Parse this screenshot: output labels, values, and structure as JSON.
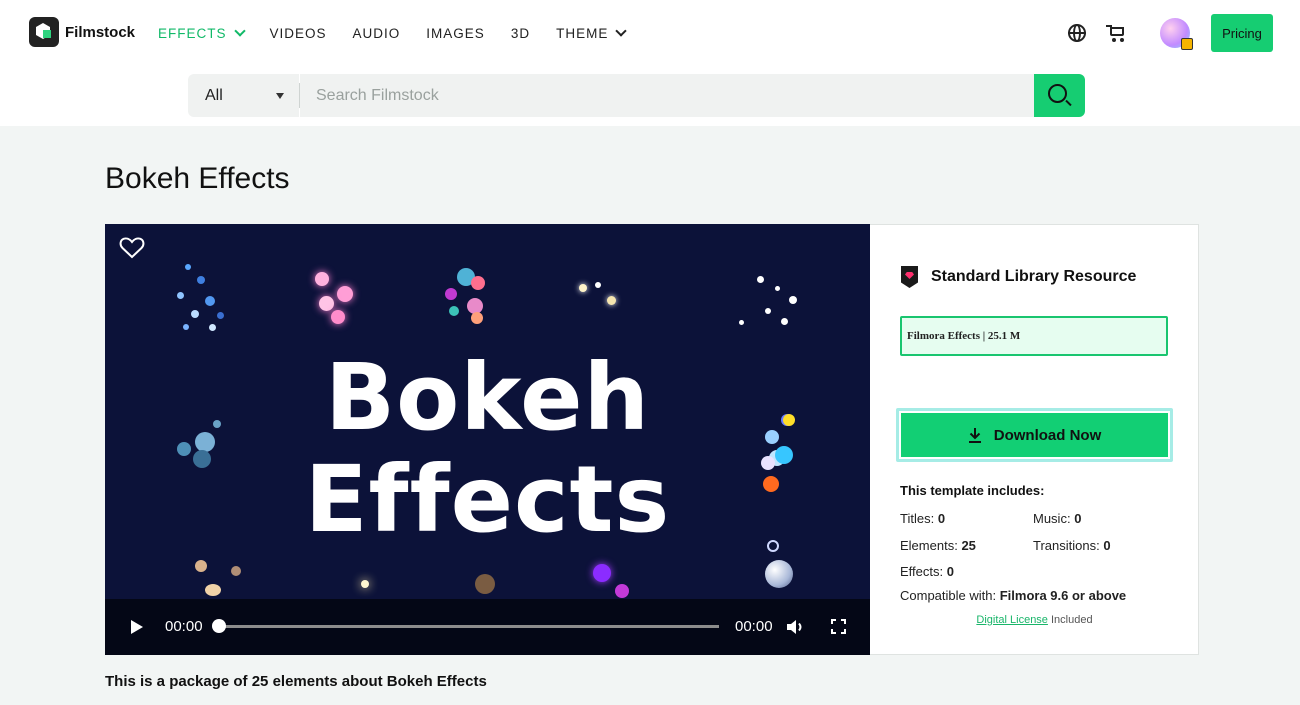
{
  "header": {
    "brand": "Filmstock",
    "nav": [
      {
        "label": "EFFECTS",
        "active": true,
        "dropdown": true
      },
      {
        "label": "VIDEOS",
        "active": false,
        "dropdown": false
      },
      {
        "label": "AUDIO",
        "active": false,
        "dropdown": false
      },
      {
        "label": "IMAGES",
        "active": false,
        "dropdown": false
      },
      {
        "label": "3D",
        "active": false,
        "dropdown": false
      },
      {
        "label": "THEME",
        "active": false,
        "dropdown": true
      }
    ],
    "pricing_label": "Pricing",
    "icons": [
      "globe-icon",
      "cart-icon",
      "avatar"
    ]
  },
  "search": {
    "category": "All",
    "placeholder": "Search Filmstock"
  },
  "page": {
    "title": "Bokeh Effects",
    "description": "This is a package of 25 elements about Bokeh Effects"
  },
  "player": {
    "preview_line1": "Bokeh",
    "preview_line2": "Effects",
    "current_time": "00:00",
    "duration": "00:00",
    "progress": 0
  },
  "resource": {
    "tier": "Standard Library Resource",
    "file_info": "Filmora Effects | 25.1 M",
    "download_label": "Download Now",
    "includes_title": "This template includes:",
    "titles_label": "Titles:",
    "titles_value": "0",
    "music_label": "Music:",
    "music_value": "0",
    "elements_label": "Elements:",
    "elements_value": "25",
    "transitions_label": "Transitions:",
    "transitions_value": "0",
    "effects_label": "Effects:",
    "effects_value": "0",
    "compat_label": "Compatible with:",
    "compat_value": "Filmora 9.6 or above",
    "license_link": "Digital License",
    "license_suffix": " Included"
  },
  "colors": {
    "accent": "#16cd72",
    "player_bg": "#0c1239",
    "nav_active": "#11b968"
  }
}
